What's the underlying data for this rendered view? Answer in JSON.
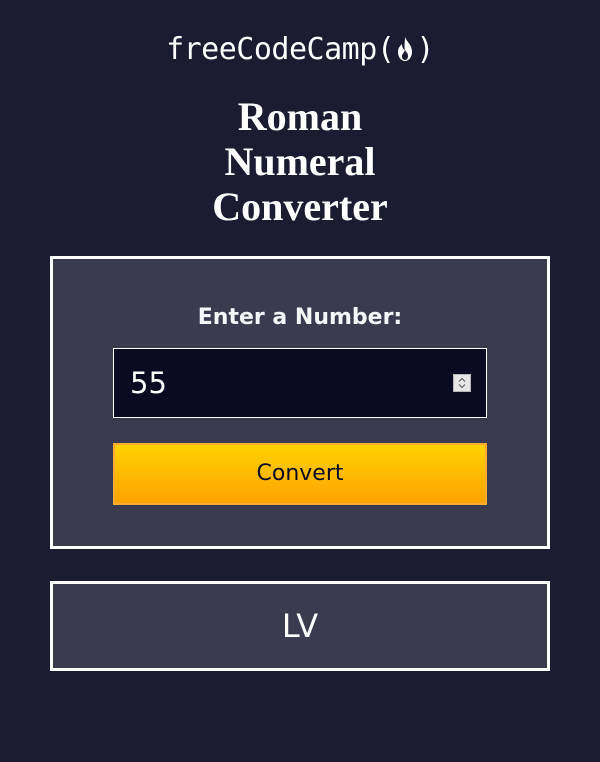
{
  "header": {
    "logo_name": "freeCodeCamp",
    "logo_open": "(",
    "logo_close": ")"
  },
  "title": {
    "line1": "Roman",
    "line2": "Numeral",
    "line3": "Converter"
  },
  "form": {
    "label": "Enter a Number:",
    "input_value": "55",
    "button_label": "Convert"
  },
  "output": {
    "result": "LV"
  },
  "colors": {
    "background": "#1b1b32",
    "panel": "#3b3b4f",
    "input_bg": "#0a0a23",
    "button_top": "#ffd200",
    "button_bottom": "#ffa300",
    "text": "#ffffff"
  },
  "icons": {
    "logo_flame": "flame-icon",
    "spinner": "spinner-arrows-icon"
  }
}
